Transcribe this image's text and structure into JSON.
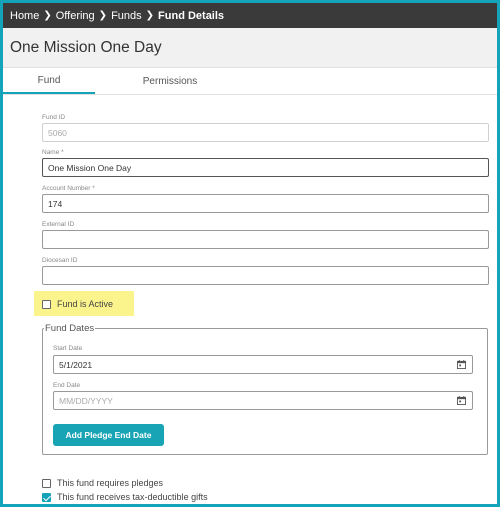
{
  "breadcrumb": {
    "items": [
      "Home",
      "Offering",
      "Funds"
    ],
    "current": "Fund Details"
  },
  "page": {
    "title": "One Mission One Day"
  },
  "tabs": [
    {
      "label": "Fund",
      "active": true
    },
    {
      "label": "Permissions",
      "active": false
    }
  ],
  "form": {
    "fund_id": {
      "label": "Fund ID",
      "value": "5060"
    },
    "name": {
      "label": "Name *",
      "value": "One Mission One Day"
    },
    "account_number": {
      "label": "Account Number *",
      "value": "174"
    },
    "external_id": {
      "label": "External ID",
      "value": ""
    },
    "diocesan_id": {
      "label": "Diocesan ID",
      "value": ""
    },
    "fund_active": {
      "label": "Fund is Active",
      "checked": false
    },
    "fund_dates": {
      "legend": "Fund Dates",
      "start_date": {
        "label": "Start Date",
        "value": "5/1/2021"
      },
      "end_date": {
        "label": "End Date",
        "placeholder": "MM/DD/YYYY"
      },
      "add_pledge_button": "Add Pledge End Date"
    },
    "requires_pledges": {
      "label": "This fund requires pledges",
      "checked": false
    },
    "tax_deductible": {
      "label": "This fund receives tax-deductible gifts",
      "checked": true
    }
  },
  "colors": {
    "accent": "#14a3b8",
    "highlight": "#fbf48c",
    "breadcrumb_bg": "#3a3a3a"
  },
  "icons": [
    "chevron-right-icon",
    "calendar-icon",
    "checkbox-icon"
  ]
}
